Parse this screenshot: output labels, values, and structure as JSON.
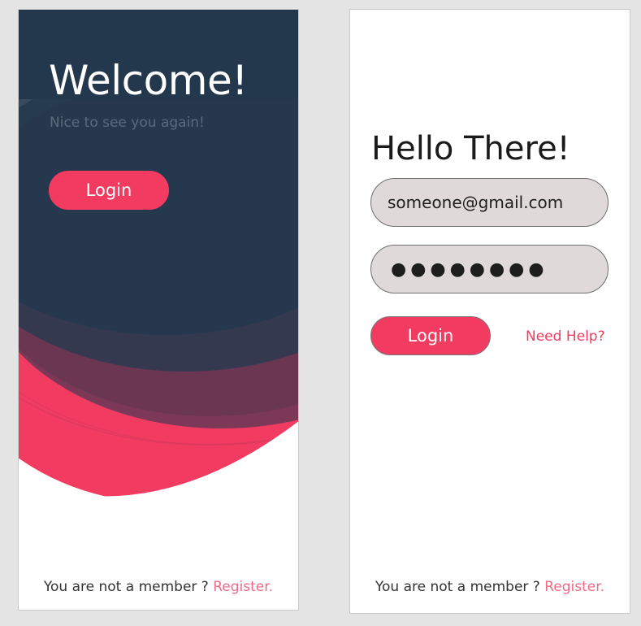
{
  "colors": {
    "page_bg": "#e4e4e4",
    "navy": "#24384d",
    "accent": "#f23b61",
    "link": "#ee6a86",
    "field_bg": "#dfd9d9"
  },
  "welcome_screen": {
    "title": "Welcome!",
    "subtitle": "Nice to see you again!",
    "login_label": "Login",
    "footer_text": "You are not a member ? ",
    "register_label": "Register."
  },
  "login_screen": {
    "title": "Hello There!",
    "email_value": "someone@gmail.com",
    "password_value": "●●●●●●●●",
    "login_label": "Login",
    "help_label": "Need Help?",
    "footer_text": "You are not a member ? ",
    "register_label": "Register."
  }
}
